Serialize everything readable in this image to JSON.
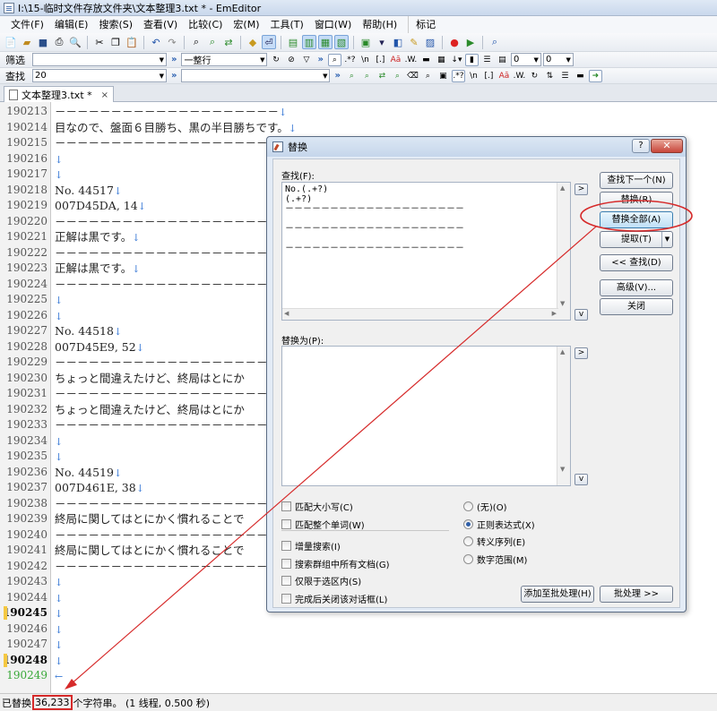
{
  "window": {
    "title": "I:\\15-临时文件存放文件夹\\文本整理3.txt * - EmEditor"
  },
  "menu": [
    "文件(F)",
    "编辑(E)",
    "搜索(S)",
    "查看(V)",
    "比较(C)",
    "宏(M)",
    "工具(T)",
    "窗口(W)",
    "帮助(H)"
  ],
  "menu_extra": "标记",
  "filter_bar": {
    "label": "筛选",
    "value": "",
    "mode": "一整行",
    "spin1": "0",
    "spin2": "0"
  },
  "find_bar": {
    "label": "查找",
    "value": "20"
  },
  "tab": {
    "label": "文本整理3.txt *",
    "close": "×"
  },
  "editor": {
    "newline_glyph": "↓",
    "eof_glyph": "←",
    "lines": [
      {
        "no": "190213",
        "text": "－－－－－－－－－－－－－－－－－－－－",
        "nl": true
      },
      {
        "no": "190214",
        "text": "目なので、盤面６目勝ち、黒の半目勝ちです。",
        "nl": true
      },
      {
        "no": "190215",
        "text": "－－－－－－－－－－－－－－－－－－－－",
        "nl": true
      },
      {
        "no": "190216",
        "text": "",
        "nl": true
      },
      {
        "no": "190217",
        "text": "",
        "nl": true
      },
      {
        "no": "190218",
        "text": "No. 44517",
        "nl": true
      },
      {
        "no": "190219",
        "text": "007D45DA, 14",
        "nl": true
      },
      {
        "no": "190220",
        "text": "－－－－－－－－－－－－－－－－－－－－",
        "nl": true
      },
      {
        "no": "190221",
        "text": "正解は黒です。",
        "nl": true
      },
      {
        "no": "190222",
        "text": "－－－－－－－－－－－－－－－－－－－－",
        "nl": true
      },
      {
        "no": "190223",
        "text": "正解は黒です。",
        "nl": true
      },
      {
        "no": "190224",
        "text": "－－－－－－－－－－－－－－－－－－－－",
        "nl": true
      },
      {
        "no": "190225",
        "text": "",
        "nl": true
      },
      {
        "no": "190226",
        "text": "",
        "nl": true
      },
      {
        "no": "190227",
        "text": "No. 44518",
        "nl": true
      },
      {
        "no": "190228",
        "text": "007D45E9, 52",
        "nl": true
      },
      {
        "no": "190229",
        "text": "－－－－－－－－－－－－－－－－－－－－",
        "nl": false
      },
      {
        "no": "190230",
        "text": "ちょっと間違えたけど、終局はとにか",
        "nl": false
      },
      {
        "no": "190231",
        "text": "－－－－－－－－－－－－－－－－－－－－",
        "nl": false
      },
      {
        "no": "190232",
        "text": "ちょっと間違えたけど、終局はとにか",
        "nl": false
      },
      {
        "no": "190233",
        "text": "－－－－－－－－－－－－－－－－－－－－",
        "nl": true
      },
      {
        "no": "190234",
        "text": "",
        "nl": true
      },
      {
        "no": "190235",
        "text": "",
        "nl": true
      },
      {
        "no": "190236",
        "text": "No. 44519",
        "nl": true
      },
      {
        "no": "190237",
        "text": "007D461E, 38",
        "nl": true
      },
      {
        "no": "190238",
        "text": "－－－－－－－－－－－－－－－－－－－－",
        "nl": false
      },
      {
        "no": "190239",
        "text": "終局に関してはとにかく慣れることで",
        "nl": false
      },
      {
        "no": "190240",
        "text": "－－－－－－－－－－－－－－－－－－－－",
        "nl": false
      },
      {
        "no": "190241",
        "text": "終局に関してはとにかく慣れることで",
        "nl": false
      },
      {
        "no": "190242",
        "text": "－－－－－－－－－－－－－－－－－－－－",
        "nl": true
      },
      {
        "no": "190243",
        "text": "",
        "nl": true
      },
      {
        "no": "190244",
        "text": "",
        "nl": true
      },
      {
        "no": "190245",
        "text": "",
        "nl": true
      },
      {
        "no": "190246",
        "text": "",
        "nl": true
      },
      {
        "no": "190247",
        "text": "",
        "nl": true
      },
      {
        "no": "190248",
        "text": "",
        "nl": true
      },
      {
        "no": "190249",
        "text": "",
        "nl": false,
        "eof": true
      }
    ]
  },
  "status": {
    "prefix": "已替换",
    "count": "36,233",
    "suffix": "个字符串。 (1 线程, 0.500 秒)"
  },
  "dialog": {
    "title": "替换",
    "help": "?",
    "close": "✕",
    "find_label": "查找(F):",
    "find_text": "No.(.+?)\n(.+?)\n－－－－－－－－－－－－－－－－－－－－\n\n－－－－－－－－－－－－－－－－－－－－\n\n－－－－－－－－－－－－－－－－－－－－",
    "replace_label": "替换为(P):",
    "replace_text": "",
    "side_btn": ">",
    "side_btn_down": "v",
    "buttons": {
      "find_next": "查找下一个(N)",
      "replace": "替换(R)",
      "replace_all": "替换全部(A)",
      "extract": "提取(T)",
      "find_back": "<< 查找(D)",
      "advanced": "高级(V)...",
      "close": "关闭",
      "add_batch": "添加至批处理(H)",
      "batch": "批处理 >>"
    },
    "checkboxes": [
      {
        "label": "匹配大小写(C)",
        "checked": false
      },
      {
        "label": "匹配整个单词(W)",
        "checked": false
      },
      {
        "label": "增量搜索(I)",
        "checked": false
      },
      {
        "label": "搜索群组中所有文档(G)",
        "checked": false
      },
      {
        "label": "仅限于选区内(S)",
        "checked": false
      },
      {
        "label": "完成后关闭该对话框(L)",
        "checked": false
      }
    ],
    "radios": [
      {
        "label": "(无)(O)",
        "selected": false
      },
      {
        "label": "正则表达式(X)",
        "selected": true
      },
      {
        "label": "转义序列(E)",
        "selected": false
      },
      {
        "label": "数字范围(M)",
        "selected": false
      }
    ]
  },
  "colors": {
    "annotation": "#d62a2a",
    "newline": "#3a7ad6",
    "modified_marker": "#f5c842"
  }
}
